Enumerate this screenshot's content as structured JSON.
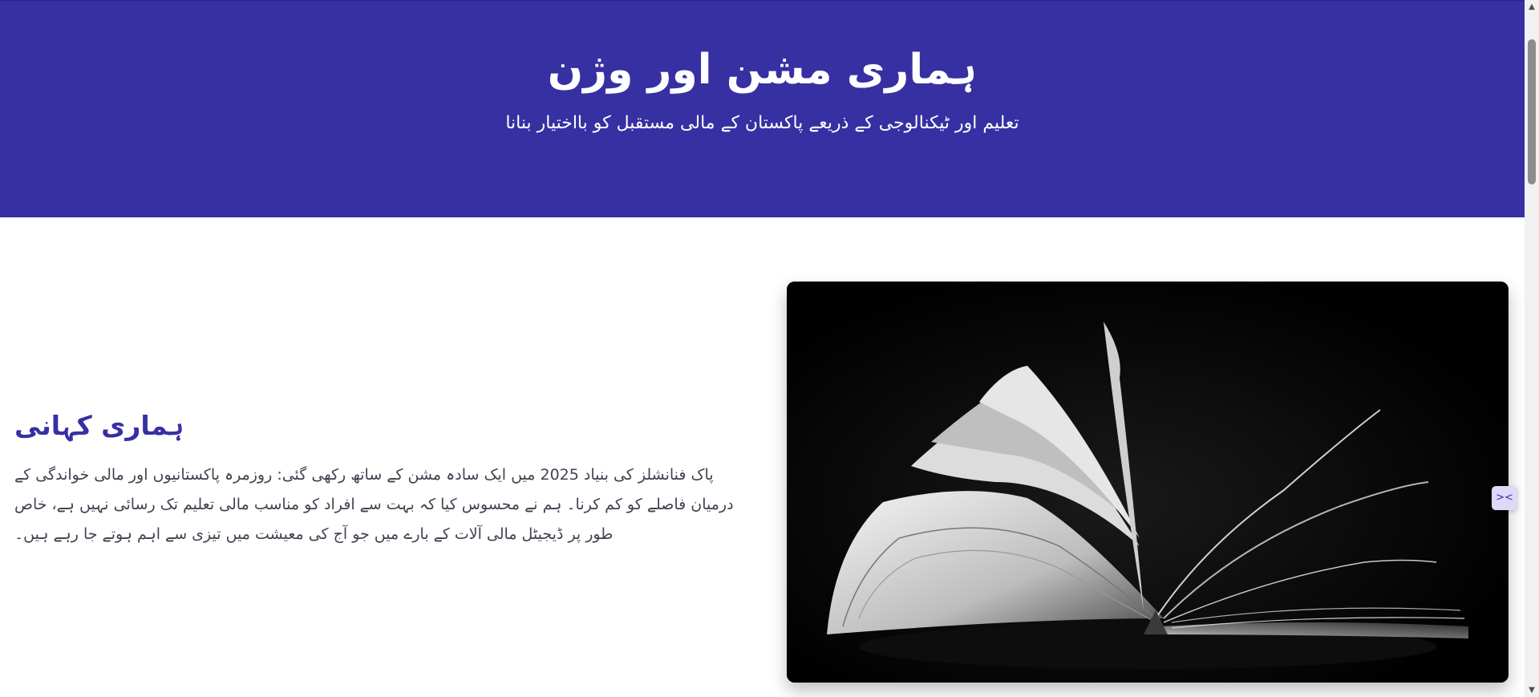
{
  "hero": {
    "title": "ہماری مشن اور وژن",
    "subtitle": "تعلیم اور ٹیکنالوجی کے ذریعے پاکستان کے مالی مستقبل کو بااختیار بنانا",
    "background_color": "#3730a3"
  },
  "story": {
    "heading": "ہماری کہانی",
    "body": "پاک فنانشلز کی بنیاد 2025 میں ایک سادہ مشن کے ساتھ رکھی گئی: روزمرہ پاکستانیوں اور مالی خواندگی کے درمیان فاصلے کو کم کرنا۔ ہم نے محسوس کیا کہ بہت سے افراد کو مناسب مالی تعلیم تک رسائی نہیں ہے، خاص طور پر ڈیجیٹل مالی آلات کے بارے میں جو آج کی معیشت میں تیزی سے اہم ہوتے جا رہے ہیں۔",
    "heading_color": "#3730a3"
  },
  "image": {
    "subject": "open-book-photo"
  },
  "icons": {
    "side_handle": "collapse-arrows-icon",
    "scroll_up": "scroll-up-arrow-icon",
    "scroll_down": "scroll-down-arrow-icon"
  }
}
